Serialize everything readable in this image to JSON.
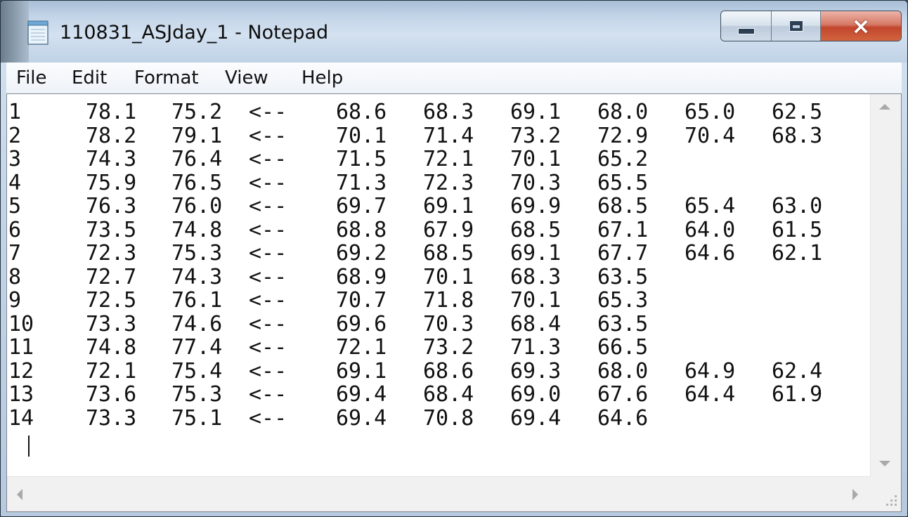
{
  "window": {
    "title": "110831_ASJday_1 - Notepad",
    "icon": "notepad-icon",
    "controls": {
      "minimize": "minimize-icon",
      "maximize": "maximize-icon",
      "close": "×"
    }
  },
  "menu": [
    "File",
    "Edit",
    "Format",
    "View",
    "Help"
  ],
  "document": {
    "rows": [
      [
        "1",
        "78.1",
        "75.2",
        "<--",
        "68.6",
        "68.3",
        "69.1",
        "68.0",
        "65.0",
        "62.5"
      ],
      [
        "2",
        "78.2",
        "79.1",
        "<--",
        "70.1",
        "71.4",
        "73.2",
        "72.9",
        "70.4",
        "68.3"
      ],
      [
        "3",
        "74.3",
        "76.4",
        "<--",
        "71.5",
        "72.1",
        "70.1",
        "65.2",
        "",
        ""
      ],
      [
        "4",
        "75.9",
        "76.5",
        "<--",
        "71.3",
        "72.3",
        "70.3",
        "65.5",
        "",
        ""
      ],
      [
        "5",
        "76.3",
        "76.0",
        "<--",
        "69.7",
        "69.1",
        "69.9",
        "68.5",
        "65.4",
        "63.0"
      ],
      [
        "6",
        "73.5",
        "74.8",
        "<--",
        "68.8",
        "67.9",
        "68.5",
        "67.1",
        "64.0",
        "61.5"
      ],
      [
        "7",
        "72.3",
        "75.3",
        "<--",
        "69.2",
        "68.5",
        "69.1",
        "67.7",
        "64.6",
        "62.1"
      ],
      [
        "8",
        "72.7",
        "74.3",
        "<--",
        "68.9",
        "70.1",
        "68.3",
        "63.5",
        "",
        ""
      ],
      [
        "9",
        "72.5",
        "76.1",
        "<--",
        "70.7",
        "71.8",
        "70.1",
        "65.3",
        "",
        ""
      ],
      [
        "10",
        "73.3",
        "74.6",
        "<--",
        "69.6",
        "70.3",
        "68.4",
        "63.5",
        "",
        ""
      ],
      [
        "11",
        "74.8",
        "77.4",
        "<--",
        "72.1",
        "73.2",
        "71.3",
        "66.5",
        "",
        ""
      ],
      [
        "12",
        "72.1",
        "75.4",
        "<--",
        "69.1",
        "68.6",
        "69.3",
        "68.0",
        "64.9",
        "62.4"
      ],
      [
        "13",
        "73.6",
        "75.3",
        "<--",
        "69.4",
        "68.4",
        "69.0",
        "67.6",
        "64.4",
        "61.9"
      ],
      [
        "14",
        "73.3",
        "75.1",
        "<--",
        "69.4",
        "70.8",
        "69.4",
        "64.6",
        "",
        ""
      ]
    ]
  }
}
